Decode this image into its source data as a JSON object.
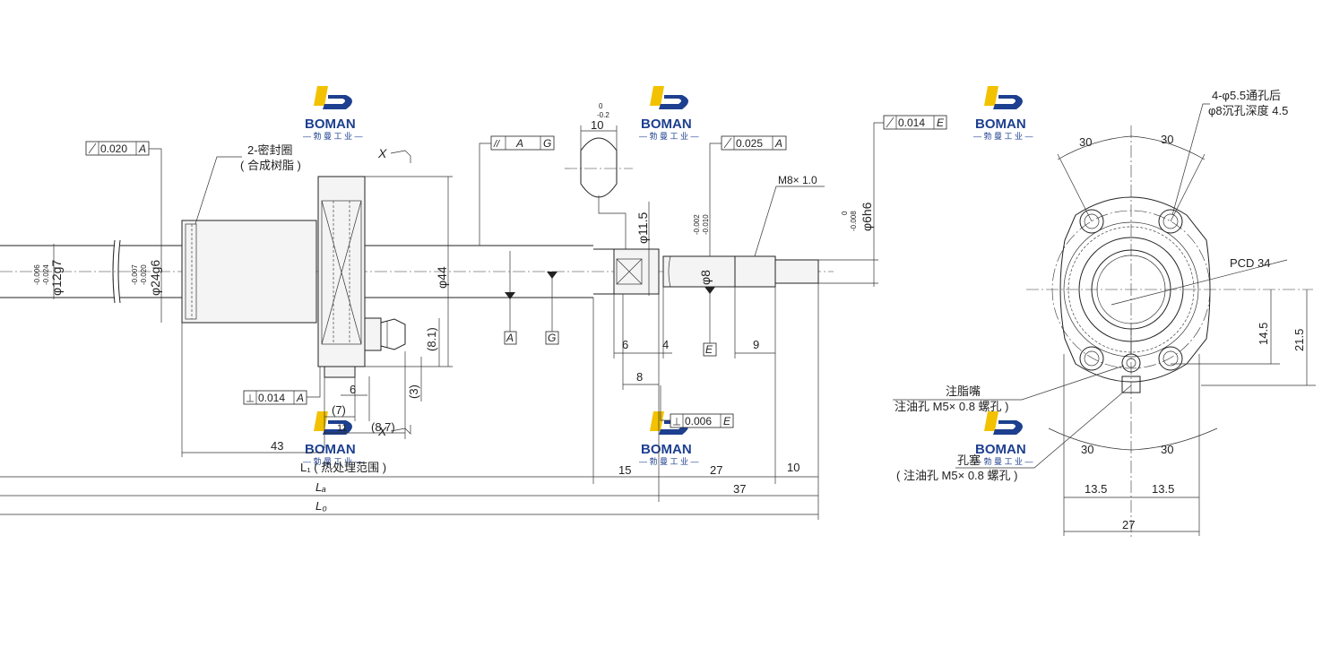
{
  "brand": {
    "name": "BOMAN",
    "sub": "— 勃 曼 工 业 —",
    "colors": {
      "blue": "#1d3f8f",
      "yellow": "#f2c200"
    }
  },
  "tolerances": {
    "runout_a_left": "0.020",
    "runout_a_left_ref": "A",
    "perp_a": "0.014",
    "perp_a_ref": "A",
    "parallel_ag": "//",
    "parallel_a": "A",
    "parallel_g": "G",
    "runout_a_mid": "0.025",
    "runout_a_mid_ref": "A",
    "runout_e": "0.014",
    "runout_e_ref": "E",
    "perp_e": "0.006",
    "perp_e_ref": "E"
  },
  "labels": {
    "seal_line1": "2-密封圈",
    "seal_line2": "( 合成树脂 )",
    "section_x": "X",
    "thread": "M8× 1.0",
    "datum_a": "A",
    "datum_g": "G",
    "datum_e": "E",
    "grease_nipple": "注脂嘴",
    "grease_hole": "注油孔 M5× 0.8 螺孔 )",
    "plug": "孔塞",
    "plug_hole": "( 注油孔 M5× 0.8 螺孔 )",
    "holes_line1": "4-φ5.5通孔后",
    "holes_line2": "φ8沉孔深度 4.5",
    "pcd": "PCD 34"
  },
  "dimensions": {
    "d_12g7": "φ12g7",
    "d_12g7_tol_u": "-0.006",
    "d_12g7_tol_l": "-0.024",
    "d_24g6": "φ24g6",
    "d_24g6_tol_u": "-0.007",
    "d_24g6_tol_l": "-0.020",
    "d_44": "φ44",
    "d_11_5": "φ11.5",
    "d_8": "φ8",
    "d_8_tol_u": "-0.002",
    "d_8_tol_l": "-0.010",
    "d_6h6": "φ6h6",
    "d_6h6_tol_u": "0",
    "d_6h6_tol_l": "-0.008",
    "flat_10": "10",
    "flat_10_tol_u": "0",
    "flat_10_tol_l": "-0.2",
    "len_8_1": "(8.1)",
    "len_3": "(3)",
    "len_6a": "6",
    "len_7": "(7)",
    "len_11": "11",
    "len_8_7": "(8.7)",
    "len_43": "43",
    "len_6b": "6",
    "len_4": "4",
    "len_8": "8",
    "len_9": "9",
    "len_15": "15",
    "len_27": "27",
    "len_10": "10",
    "len_37": "37",
    "l1": "L₁ ( 热处理范围 )",
    "la": "Lₐ",
    "l0": "L₀",
    "ang_30_tl": "30",
    "ang_30_tr": "30",
    "ang_30_bl": "30",
    "ang_30_br": "30",
    "h_14_5": "14.5",
    "h_21_5": "21.5",
    "w_13_5_l": "13.5",
    "w_13_5_r": "13.5",
    "w_27": "27"
  }
}
